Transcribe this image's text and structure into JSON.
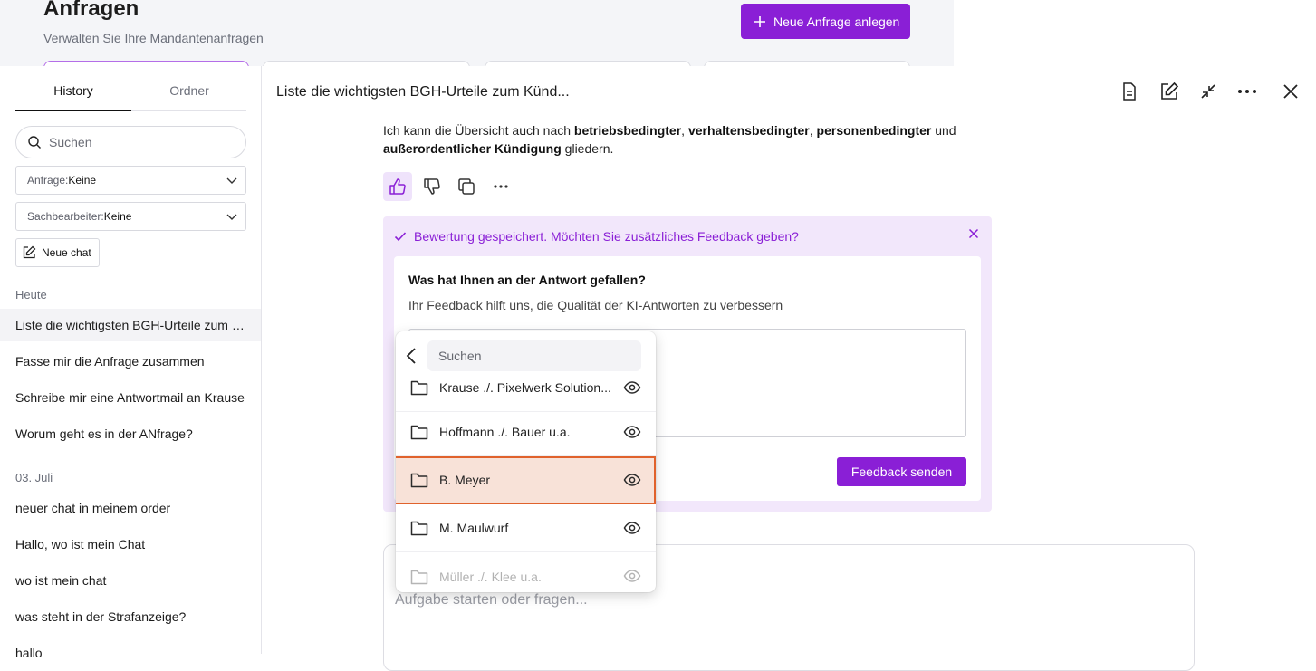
{
  "background": {
    "title": "Anfragen",
    "subtitle": "Verwalten Sie Ihre Mandantenanfragen",
    "new_request_label": "Neue Anfrage anlegen"
  },
  "sidebar": {
    "tabs": [
      {
        "label": "History"
      },
      {
        "label": "Ordner"
      }
    ],
    "search_placeholder": "Suchen",
    "filters": [
      {
        "label": "Anfrage:",
        "value": "Keine"
      },
      {
        "label": "Sachbearbeiter:",
        "value": "Keine"
      }
    ],
    "new_chat_label": "Neue chat",
    "groups": [
      {
        "label": "Heute",
        "items": [
          "Liste die wichtigsten BGH-Urteile zum Kündigungsschutz",
          "Fasse mir die Anfrage zusammen",
          "Schreibe mir eine Antwortmail an Krause",
          "Worum geht es in der ANfrage?"
        ]
      },
      {
        "label": "03. Juli",
        "items": [
          "neuer chat in meinem order",
          "Hallo, wo ist mein Chat",
          "wo ist mein chat",
          "was steht in der Strafanzeige?",
          "hallo"
        ]
      }
    ]
  },
  "main": {
    "title": "Liste die wichtigsten BGH-Urteile zum Künd...",
    "answer": {
      "prefix": "Ich kann die Übersicht auch nach ",
      "b1": "betriebsbedingter",
      "sep1": ", ",
      "b2": "verhaltensbedingter",
      "sep2": ", ",
      "b3": "personenbedingter",
      "sep3": " und ",
      "b4": "außerordentlicher Kündigung",
      "suffix": " gliedern."
    },
    "feedback": {
      "status": "Bewertung gespeichert. Möchten Sie zusätzliches Feedback geben?",
      "question": "Was hat Ihnen an der Antwort gefallen?",
      "subtitle": "Ihr Feedback hilft uns, die Qualität der KI-Antworten zu verbessern",
      "send_label": "Feedback senden"
    },
    "composer_placeholder": "Aufgabe starten oder fragen..."
  },
  "folder_dropdown": {
    "search_placeholder": "Suchen",
    "items": [
      {
        "name": "Krause ./. Pixelwerk Solution...",
        "state": "partial"
      },
      {
        "name": "Hoffmann ./. Bauer u.a.",
        "state": "normal"
      },
      {
        "name": "B. Meyer",
        "state": "selected"
      },
      {
        "name": "M. Maulwurf",
        "state": "normal"
      },
      {
        "name": "Müller ./. Klee u.a.",
        "state": "fade"
      }
    ]
  },
  "colors": {
    "accent": "#8a1fd6",
    "feedback_bg": "#f2e7fb",
    "selected_bg": "#f8e2d8",
    "selected_border": "#e0622c"
  }
}
